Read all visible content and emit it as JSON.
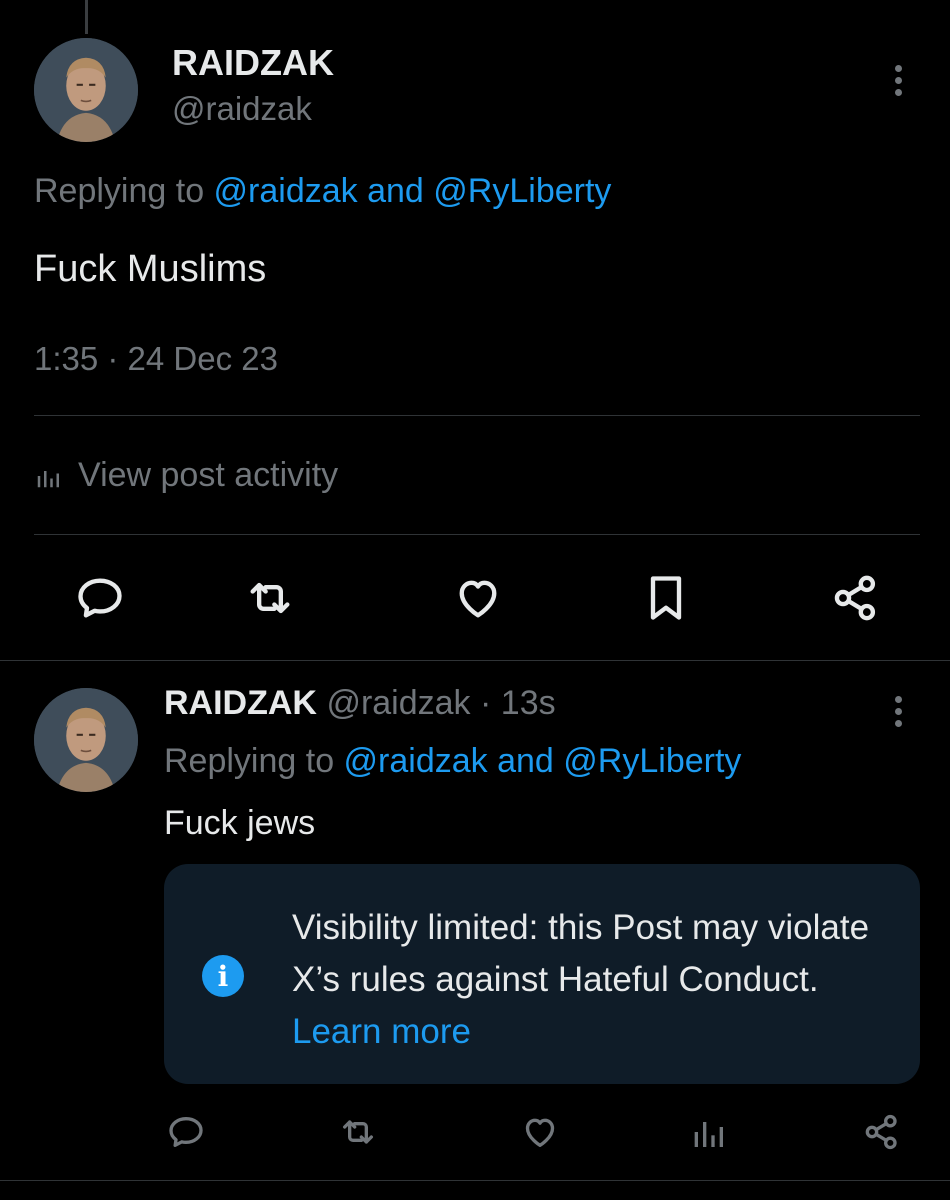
{
  "post1": {
    "author_name": "RAIDZAK",
    "author_handle": "@raidzak",
    "replying_prefix": "Replying to ",
    "mention_1": "@raidzak",
    "mention_join": " and ",
    "mention_2": "@RyLiberty",
    "text": "Fuck Muslims",
    "timestamp": "1:35 · 24 Dec 23",
    "activity_label": "View post activity",
    "actions": [
      "reply-icon",
      "repost-icon",
      "like-icon",
      "bookmark-icon",
      "share-icon"
    ]
  },
  "post2": {
    "author_name": "RAIDZAK",
    "author_handle": "@raidzak",
    "separator": " · ",
    "age": "13s",
    "replying_prefix": "Replying to ",
    "mention_1": "@raidzak",
    "mention_join": " and ",
    "mention_2": "@RyLiberty",
    "text": "Fuck jews",
    "notice": {
      "icon": "info-icon",
      "icon_glyph": "i",
      "message": "Visibility limited: this Post may violate X’s rules against Hateful Conduct. ",
      "link": "Learn more"
    },
    "actions": [
      "reply-icon",
      "repost-icon",
      "like-icon",
      "views-icon",
      "share-icon"
    ]
  },
  "colors": {
    "background": "#000000",
    "text_primary": "#e7e9ea",
    "text_secondary": "#71767b",
    "accent": "#1d9bf0",
    "divider": "#2f3336",
    "notice_bg": "#0f1c28"
  }
}
